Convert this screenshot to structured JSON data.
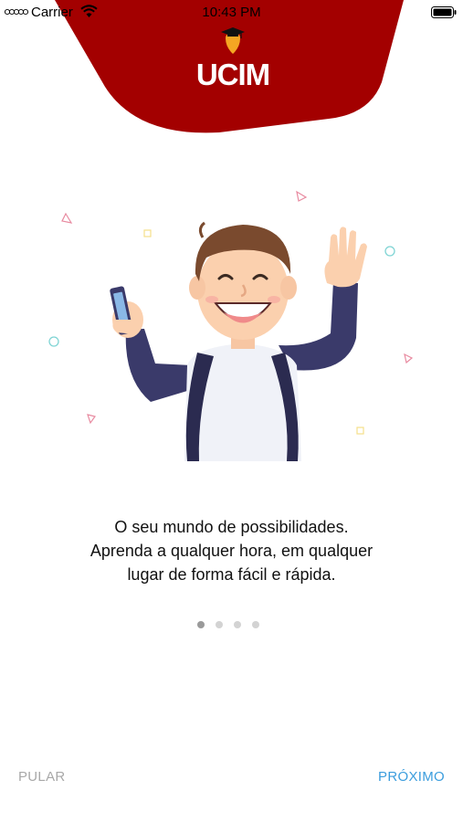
{
  "status_bar": {
    "carrier": "Carrier",
    "time": "10:43 PM"
  },
  "logo": {
    "text": "UCIM"
  },
  "colors": {
    "brand_red": "#a30000",
    "accent_blue": "#3b9ddd",
    "muted_gray": "#a8a8a8"
  },
  "tagline": {
    "line1": "O seu mundo de possibilidades.",
    "line2": "Aprenda a qualquer hora, em qualquer",
    "line3": "lugar de forma fácil e rápida."
  },
  "pager": {
    "total": 4,
    "active": 1
  },
  "buttons": {
    "skip": "PULAR",
    "next": "PRÓXIMO"
  }
}
